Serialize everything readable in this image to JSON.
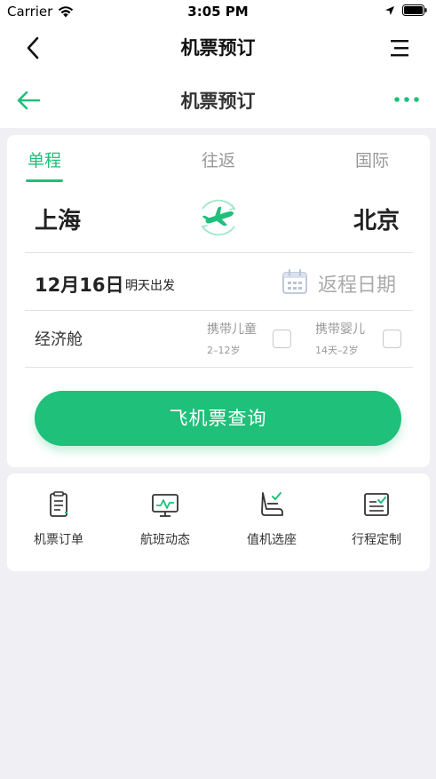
{
  "status_bar": {
    "carrier": "Carrier",
    "time": "3:05 PM"
  },
  "nav_top": {
    "title": "机票预订"
  },
  "nav_sub": {
    "title": "机票预订"
  },
  "trip_tabs": [
    {
      "label": "单程",
      "active": true
    },
    {
      "label": "往返",
      "active": false
    },
    {
      "label": "国际",
      "active": false
    }
  ],
  "route": {
    "from": "上海",
    "to": "北京"
  },
  "date": {
    "depart": "12月16日",
    "depart_note": "明天出发",
    "return_placeholder": "返程日期"
  },
  "cabin": {
    "label": "经济舱"
  },
  "passengers": {
    "child": {
      "label": "携带儿童",
      "age": "2–12岁",
      "checked": false
    },
    "infant": {
      "label": "携带婴儿",
      "age": "14天–2岁",
      "checked": false
    }
  },
  "search_button": {
    "label": "飞机票查询"
  },
  "services": [
    {
      "label": "机票订单",
      "icon": "order-icon"
    },
    {
      "label": "航班动态",
      "icon": "flight-status-icon"
    },
    {
      "label": "值机选座",
      "icon": "seat-selection-icon"
    },
    {
      "label": "行程定制",
      "icon": "itinerary-icon"
    }
  ],
  "colors": {
    "accent": "#1ec07a",
    "background": "#efeff4"
  }
}
